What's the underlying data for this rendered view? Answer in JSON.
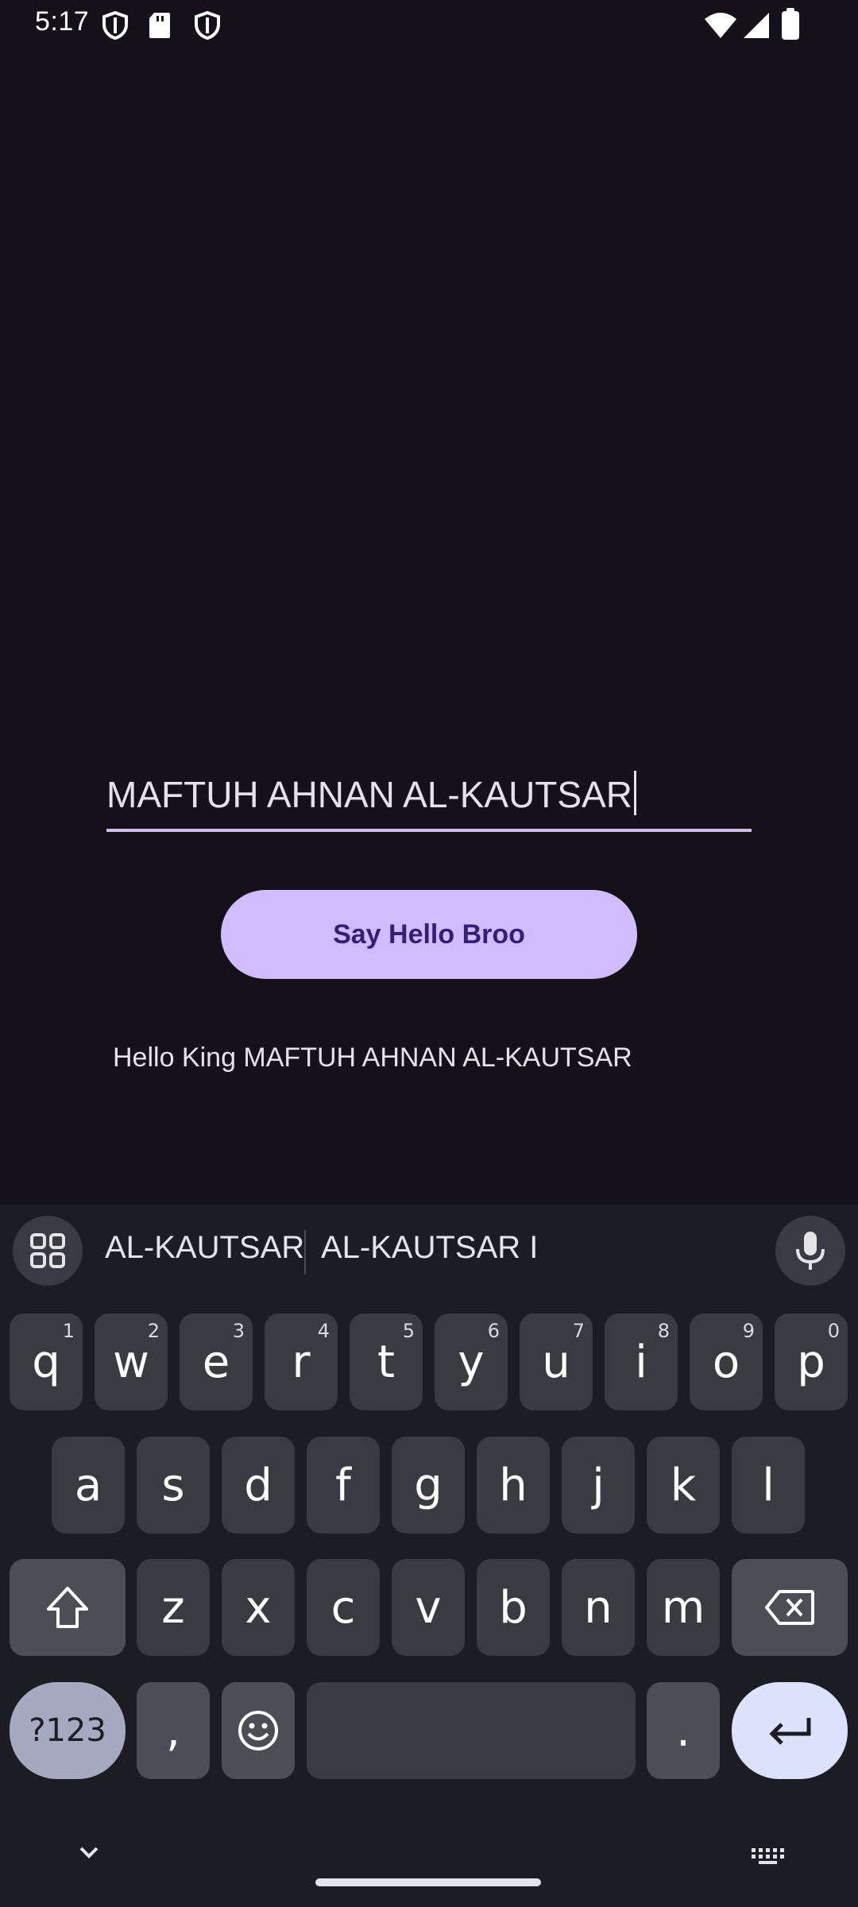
{
  "status_bar": {
    "time": "5:17",
    "left_icons": [
      "shield-icon",
      "sd-card-icon",
      "shield-icon"
    ],
    "right_icons": [
      "wifi-icon",
      "signal-icon",
      "battery-icon"
    ]
  },
  "form": {
    "name_value": "MAFTUH AHNAN AL-KAUTSAR",
    "button_label": "Say Hello Broo",
    "greeting": "Hello King MAFTUH AHNAN AL-KAUTSAR"
  },
  "keyboard": {
    "suggestions": [
      "AL-KAUTSAR",
      "AL-KAUTSAR I"
    ],
    "row1": [
      {
        "k": "q",
        "h": "1"
      },
      {
        "k": "w",
        "h": "2"
      },
      {
        "k": "e",
        "h": "3"
      },
      {
        "k": "r",
        "h": "4"
      },
      {
        "k": "t",
        "h": "5"
      },
      {
        "k": "y",
        "h": "6"
      },
      {
        "k": "u",
        "h": "7"
      },
      {
        "k": "i",
        "h": "8"
      },
      {
        "k": "o",
        "h": "9"
      },
      {
        "k": "p",
        "h": "0"
      }
    ],
    "row2": [
      "a",
      "s",
      "d",
      "f",
      "g",
      "h",
      "j",
      "k",
      "l"
    ],
    "row3": [
      "z",
      "x",
      "c",
      "v",
      "b",
      "n",
      "m"
    ],
    "symbols_label": "?123",
    "comma": ",",
    "period": "."
  },
  "colors": {
    "background": "#141218",
    "accent": "#d0bcff",
    "button_text": "#381e72",
    "keyboard_bg": "#1c1d22"
  }
}
